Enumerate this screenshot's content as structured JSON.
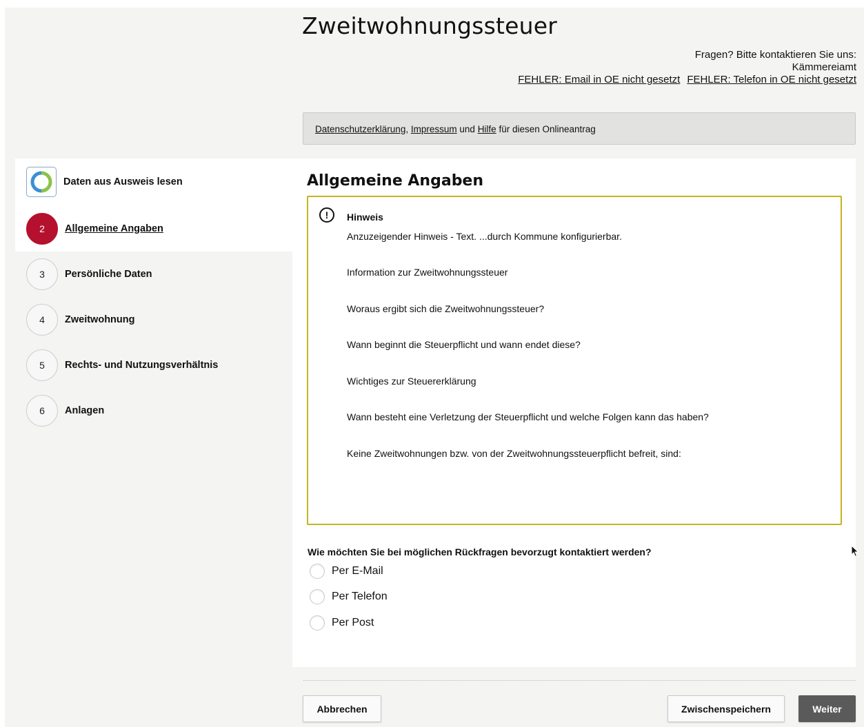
{
  "header": {
    "title": "Zweitwohnungssteuer",
    "contact_line": "Fragen? Bitte kontaktieren Sie uns:",
    "contact_office": "Kämmereiamt",
    "email_link": "FEHLER: Email in OE nicht gesetzt",
    "phone_link": "FEHLER: Telefon in OE nicht gesetzt"
  },
  "info_bar": {
    "privacy": "Datenschutzerklärung",
    "comma": ",",
    "imprint": "Impressum",
    "and": "und",
    "help": "Hilfe",
    "suffix": "für diesen Onlineantrag"
  },
  "steps": [
    {
      "number": "",
      "label": "Daten aus Ausweis lesen",
      "icon": "eid-icon"
    },
    {
      "number": "2",
      "label": "Allgemeine Angaben",
      "active": true
    },
    {
      "number": "3",
      "label": "Persönliche Daten"
    },
    {
      "number": "4",
      "label": "Zweitwohnung"
    },
    {
      "number": "5",
      "label": "Rechts- und Nutzungsverhältnis"
    },
    {
      "number": "6",
      "label": "Anlagen"
    }
  ],
  "main": {
    "title": "Allgemeine Angaben",
    "notice": {
      "icon": "!",
      "heading": "Hinweis",
      "lines": [
        "Anzuzeigender Hinweis - Text. ...durch Kommune konfigurierbar.",
        "Information zur Zweitwohnungssteuer",
        "Woraus ergibt sich die Zweitwohnungssteuer?",
        "Wann beginnt die Steuerpflicht und wann endet diese?",
        "Wichtiges zur Steuererklärung",
        "Wann besteht eine Verletzung der Steuerpflicht und welche Folgen kann das haben?",
        "Keine Zweitwohnungen bzw. von der Zweitwohnungssteuerpflicht befreit, sind:"
      ]
    },
    "question": "Wie möchten Sie bei möglichen Rückfragen bevorzugt kontaktiert werden?",
    "options": [
      "Per E-Mail",
      "Per Telefon",
      "Per Post"
    ]
  },
  "footer": {
    "cancel": "Abbrechen",
    "save": "Zwischenspeichern",
    "next": "Weiter"
  },
  "colors": {
    "accent": "#b5112f",
    "notice_border": "#c7b31d",
    "primary_button": "#5a5a5a"
  }
}
